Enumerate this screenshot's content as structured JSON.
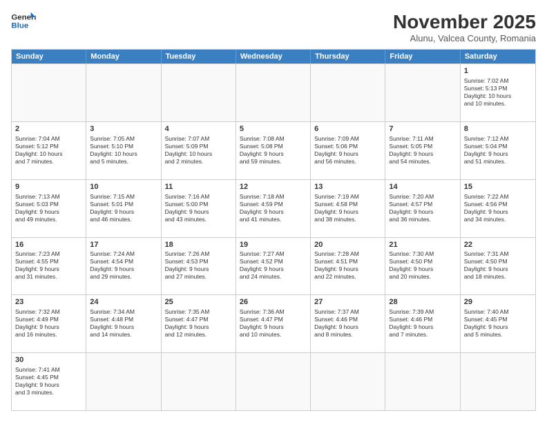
{
  "header": {
    "logo_general": "General",
    "logo_blue": "Blue",
    "title": "November 2025",
    "subtitle": "Alunu, Valcea County, Romania"
  },
  "weekdays": [
    "Sunday",
    "Monday",
    "Tuesday",
    "Wednesday",
    "Thursday",
    "Friday",
    "Saturday"
  ],
  "weeks": [
    [
      {
        "day": "",
        "info": ""
      },
      {
        "day": "",
        "info": ""
      },
      {
        "day": "",
        "info": ""
      },
      {
        "day": "",
        "info": ""
      },
      {
        "day": "",
        "info": ""
      },
      {
        "day": "",
        "info": ""
      },
      {
        "day": "1",
        "info": "Sunrise: 7:02 AM\nSunset: 5:13 PM\nDaylight: 10 hours\nand 10 minutes."
      }
    ],
    [
      {
        "day": "2",
        "info": "Sunrise: 7:04 AM\nSunset: 5:12 PM\nDaylight: 10 hours\nand 7 minutes."
      },
      {
        "day": "3",
        "info": "Sunrise: 7:05 AM\nSunset: 5:10 PM\nDaylight: 10 hours\nand 5 minutes."
      },
      {
        "day": "4",
        "info": "Sunrise: 7:07 AM\nSunset: 5:09 PM\nDaylight: 10 hours\nand 2 minutes."
      },
      {
        "day": "5",
        "info": "Sunrise: 7:08 AM\nSunset: 5:08 PM\nDaylight: 9 hours\nand 59 minutes."
      },
      {
        "day": "6",
        "info": "Sunrise: 7:09 AM\nSunset: 5:06 PM\nDaylight: 9 hours\nand 56 minutes."
      },
      {
        "day": "7",
        "info": "Sunrise: 7:11 AM\nSunset: 5:05 PM\nDaylight: 9 hours\nand 54 minutes."
      },
      {
        "day": "8",
        "info": "Sunrise: 7:12 AM\nSunset: 5:04 PM\nDaylight: 9 hours\nand 51 minutes."
      }
    ],
    [
      {
        "day": "9",
        "info": "Sunrise: 7:13 AM\nSunset: 5:03 PM\nDaylight: 9 hours\nand 49 minutes."
      },
      {
        "day": "10",
        "info": "Sunrise: 7:15 AM\nSunset: 5:01 PM\nDaylight: 9 hours\nand 46 minutes."
      },
      {
        "day": "11",
        "info": "Sunrise: 7:16 AM\nSunset: 5:00 PM\nDaylight: 9 hours\nand 43 minutes."
      },
      {
        "day": "12",
        "info": "Sunrise: 7:18 AM\nSunset: 4:59 PM\nDaylight: 9 hours\nand 41 minutes."
      },
      {
        "day": "13",
        "info": "Sunrise: 7:19 AM\nSunset: 4:58 PM\nDaylight: 9 hours\nand 38 minutes."
      },
      {
        "day": "14",
        "info": "Sunrise: 7:20 AM\nSunset: 4:57 PM\nDaylight: 9 hours\nand 36 minutes."
      },
      {
        "day": "15",
        "info": "Sunrise: 7:22 AM\nSunset: 4:56 PM\nDaylight: 9 hours\nand 34 minutes."
      }
    ],
    [
      {
        "day": "16",
        "info": "Sunrise: 7:23 AM\nSunset: 4:55 PM\nDaylight: 9 hours\nand 31 minutes."
      },
      {
        "day": "17",
        "info": "Sunrise: 7:24 AM\nSunset: 4:54 PM\nDaylight: 9 hours\nand 29 minutes."
      },
      {
        "day": "18",
        "info": "Sunrise: 7:26 AM\nSunset: 4:53 PM\nDaylight: 9 hours\nand 27 minutes."
      },
      {
        "day": "19",
        "info": "Sunrise: 7:27 AM\nSunset: 4:52 PM\nDaylight: 9 hours\nand 24 minutes."
      },
      {
        "day": "20",
        "info": "Sunrise: 7:28 AM\nSunset: 4:51 PM\nDaylight: 9 hours\nand 22 minutes."
      },
      {
        "day": "21",
        "info": "Sunrise: 7:30 AM\nSunset: 4:50 PM\nDaylight: 9 hours\nand 20 minutes."
      },
      {
        "day": "22",
        "info": "Sunrise: 7:31 AM\nSunset: 4:50 PM\nDaylight: 9 hours\nand 18 minutes."
      }
    ],
    [
      {
        "day": "23",
        "info": "Sunrise: 7:32 AM\nSunset: 4:49 PM\nDaylight: 9 hours\nand 16 minutes."
      },
      {
        "day": "24",
        "info": "Sunrise: 7:34 AM\nSunset: 4:48 PM\nDaylight: 9 hours\nand 14 minutes."
      },
      {
        "day": "25",
        "info": "Sunrise: 7:35 AM\nSunset: 4:47 PM\nDaylight: 9 hours\nand 12 minutes."
      },
      {
        "day": "26",
        "info": "Sunrise: 7:36 AM\nSunset: 4:47 PM\nDaylight: 9 hours\nand 10 minutes."
      },
      {
        "day": "27",
        "info": "Sunrise: 7:37 AM\nSunset: 4:46 PM\nDaylight: 9 hours\nand 8 minutes."
      },
      {
        "day": "28",
        "info": "Sunrise: 7:39 AM\nSunset: 4:46 PM\nDaylight: 9 hours\nand 7 minutes."
      },
      {
        "day": "29",
        "info": "Sunrise: 7:40 AM\nSunset: 4:45 PM\nDaylight: 9 hours\nand 5 minutes."
      }
    ],
    [
      {
        "day": "30",
        "info": "Sunrise: 7:41 AM\nSunset: 4:45 PM\nDaylight: 9 hours\nand 3 minutes."
      },
      {
        "day": "",
        "info": ""
      },
      {
        "day": "",
        "info": ""
      },
      {
        "day": "",
        "info": ""
      },
      {
        "day": "",
        "info": ""
      },
      {
        "day": "",
        "info": ""
      },
      {
        "day": "",
        "info": ""
      }
    ]
  ]
}
